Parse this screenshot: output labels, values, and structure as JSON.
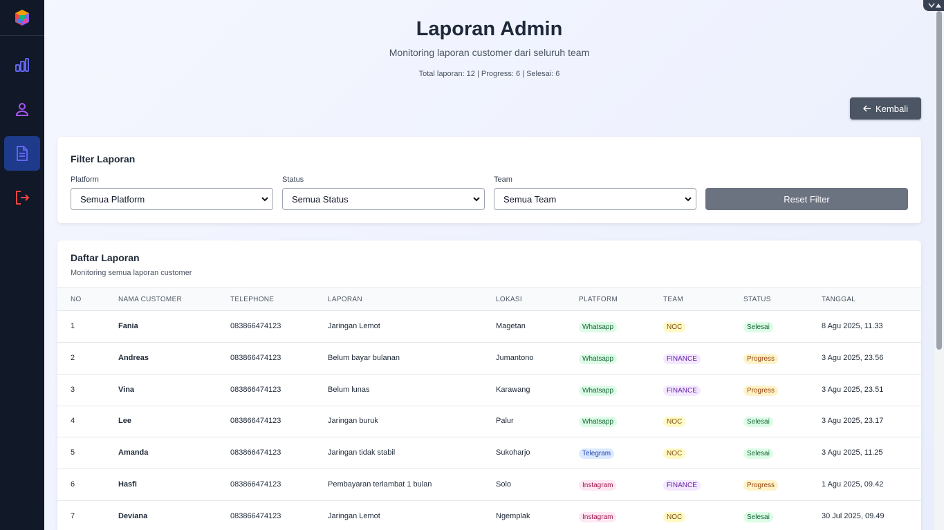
{
  "colors": {
    "sidebar": "#111827",
    "active_nav": "#1e3a8a",
    "accent_blue": "#6366f1"
  },
  "nav": [
    {
      "icon": "bar-chart-icon",
      "active": false
    },
    {
      "icon": "user-icon",
      "active": false
    },
    {
      "icon": "document-icon",
      "active": true
    },
    {
      "icon": "logout-icon",
      "active": false
    }
  ],
  "header": {
    "title": "Laporan Admin",
    "subtitle": "Monitoring laporan customer dari seluruh team",
    "stats": "Total laporan: 12 | Progress: 6 | Selesai: 6",
    "back_label": "Kembali"
  },
  "filter": {
    "title": "Filter Laporan",
    "platform_label": "Platform",
    "platform_value": "Semua Platform",
    "status_label": "Status",
    "status_value": "Semua Status",
    "team_label": "Team",
    "team_value": "Semua Team",
    "reset_label": "Reset Filter"
  },
  "list": {
    "title": "Daftar Laporan",
    "subtitle": "Monitoring semua laporan customer",
    "columns": [
      "NO",
      "NAMA CUSTOMER",
      "TELEPHONE",
      "LAPORAN",
      "LOKASI",
      "PLATFORM",
      "TEAM",
      "STATUS",
      "TANGGAL"
    ],
    "rows": [
      {
        "no": "1",
        "name": "Fania",
        "phone": "083866474123",
        "report": "Jaringan Lemot",
        "location": "Magetan",
        "platform": "Whatsapp",
        "team": "NOC",
        "status": "Selesai",
        "date": "8 Agu 2025, 11.33"
      },
      {
        "no": "2",
        "name": "Andreas",
        "phone": "083866474123",
        "report": "Belum bayar bulanan",
        "location": "Jumantono",
        "platform": "Whatsapp",
        "team": "FINANCE",
        "status": "Progress",
        "date": "3 Agu 2025, 23.56"
      },
      {
        "no": "3",
        "name": "Vina",
        "phone": "083866474123",
        "report": "Belum lunas",
        "location": "Karawang",
        "platform": "Whatsapp",
        "team": "FINANCE",
        "status": "Progress",
        "date": "3 Agu 2025, 23.51"
      },
      {
        "no": "4",
        "name": "Lee",
        "phone": "083866474123",
        "report": "Jaringan buruk",
        "location": "Palur",
        "platform": "Whatsapp",
        "team": "NOC",
        "status": "Selesai",
        "date": "3 Agu 2025, 23.17"
      },
      {
        "no": "5",
        "name": "Amanda",
        "phone": "083866474123",
        "report": "Jaringan tidak stabil",
        "location": "Sukoharjo",
        "platform": "Telegram",
        "team": "NOC",
        "status": "Selesai",
        "date": "3 Agu 2025, 11.25"
      },
      {
        "no": "6",
        "name": "Hasfi",
        "phone": "083866474123",
        "report": "Pembayaran terlambat 1 bulan",
        "location": "Solo",
        "platform": "Instagram",
        "team": "FINANCE",
        "status": "Progress",
        "date": "1 Agu 2025, 09.42"
      },
      {
        "no": "7",
        "name": "Deviana",
        "phone": "083866474123",
        "report": "Jaringan Lemot",
        "location": "Ngemplak",
        "platform": "Instagram",
        "team": "NOC",
        "status": "Selesai",
        "date": "30 Jul 2025, 09.49"
      }
    ]
  },
  "badge_colors": {
    "Whatsapp": {
      "bg": "#dcfce7",
      "fg": "#166534"
    },
    "Telegram": {
      "bg": "#dbeafe",
      "fg": "#1e40af"
    },
    "Instagram": {
      "bg": "#fce7f3",
      "fg": "#9d174d"
    },
    "NOC": {
      "bg": "#fef9c3",
      "fg": "#854d0e"
    },
    "FINANCE": {
      "bg": "#f3e8ff",
      "fg": "#6b21a8"
    },
    "Selesai": {
      "bg": "#dcfce7",
      "fg": "#166534"
    },
    "Progress": {
      "bg": "#fef3c7",
      "fg": "#92400e"
    }
  }
}
